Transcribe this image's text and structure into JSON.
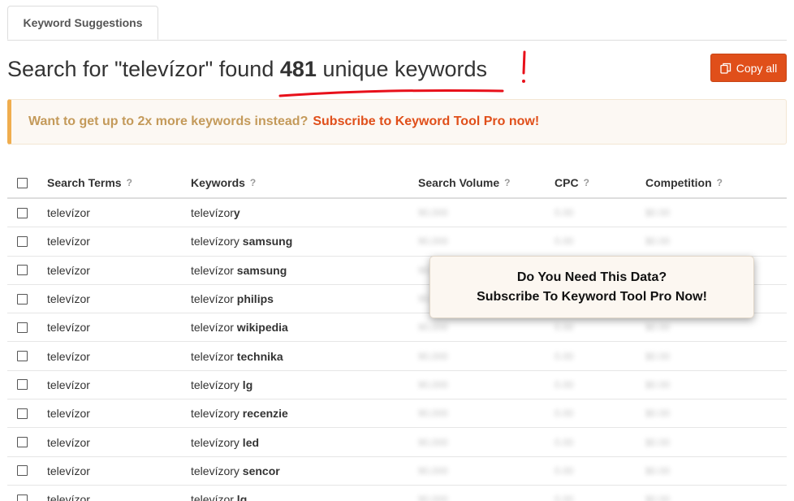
{
  "tabs": [
    {
      "label": "Keyword Suggestions"
    }
  ],
  "heading": {
    "prefix": "Search for \"televízor\" found",
    "count": "481",
    "suffix": "unique keywords"
  },
  "copy_button": {
    "label": "Copy all"
  },
  "promo": {
    "question": "Want to get up to 2x more keywords instead?",
    "link": "Subscribe to Keyword Tool Pro now!"
  },
  "table": {
    "headers": {
      "search_terms": "Search Terms",
      "keywords": "Keywords",
      "search_volume": "Search Volume",
      "cpc": "CPC",
      "competition": "Competition",
      "help": "?"
    },
    "blurred_placeholder": {
      "volume": "90,000",
      "cpc": "0.00",
      "comp": "$0.00"
    },
    "rows": [
      {
        "term": "televízor",
        "kw_base": "televízor",
        "kw_bold": "y"
      },
      {
        "term": "televízor",
        "kw_base": "televízory",
        "kw_bold": " samsung"
      },
      {
        "term": "televízor",
        "kw_base": "televízor",
        "kw_bold": " samsung"
      },
      {
        "term": "televízor",
        "kw_base": "televízor",
        "kw_bold": " philips"
      },
      {
        "term": "televízor",
        "kw_base": "televízor",
        "kw_bold": " wikipedia"
      },
      {
        "term": "televízor",
        "kw_base": "televízor",
        "kw_bold": " technika"
      },
      {
        "term": "televízor",
        "kw_base": "televízory",
        "kw_bold": " lg"
      },
      {
        "term": "televízor",
        "kw_base": "televízory",
        "kw_bold": " recenzie"
      },
      {
        "term": "televízor",
        "kw_base": "televízory",
        "kw_bold": " led"
      },
      {
        "term": "televízor",
        "kw_base": "televízory",
        "kw_bold": " sencor"
      },
      {
        "term": "televízor",
        "kw_base": "televízor",
        "kw_bold": " lg"
      }
    ]
  },
  "overlay": {
    "line1": "Do You Need This Data?",
    "line2": "Subscribe To Keyword Tool Pro Now!"
  },
  "colors": {
    "accent": "#e04f1a",
    "promo_bg": "#fcf8f3",
    "promo_border": "#f0ad4e",
    "annotation": "#e8101a"
  }
}
